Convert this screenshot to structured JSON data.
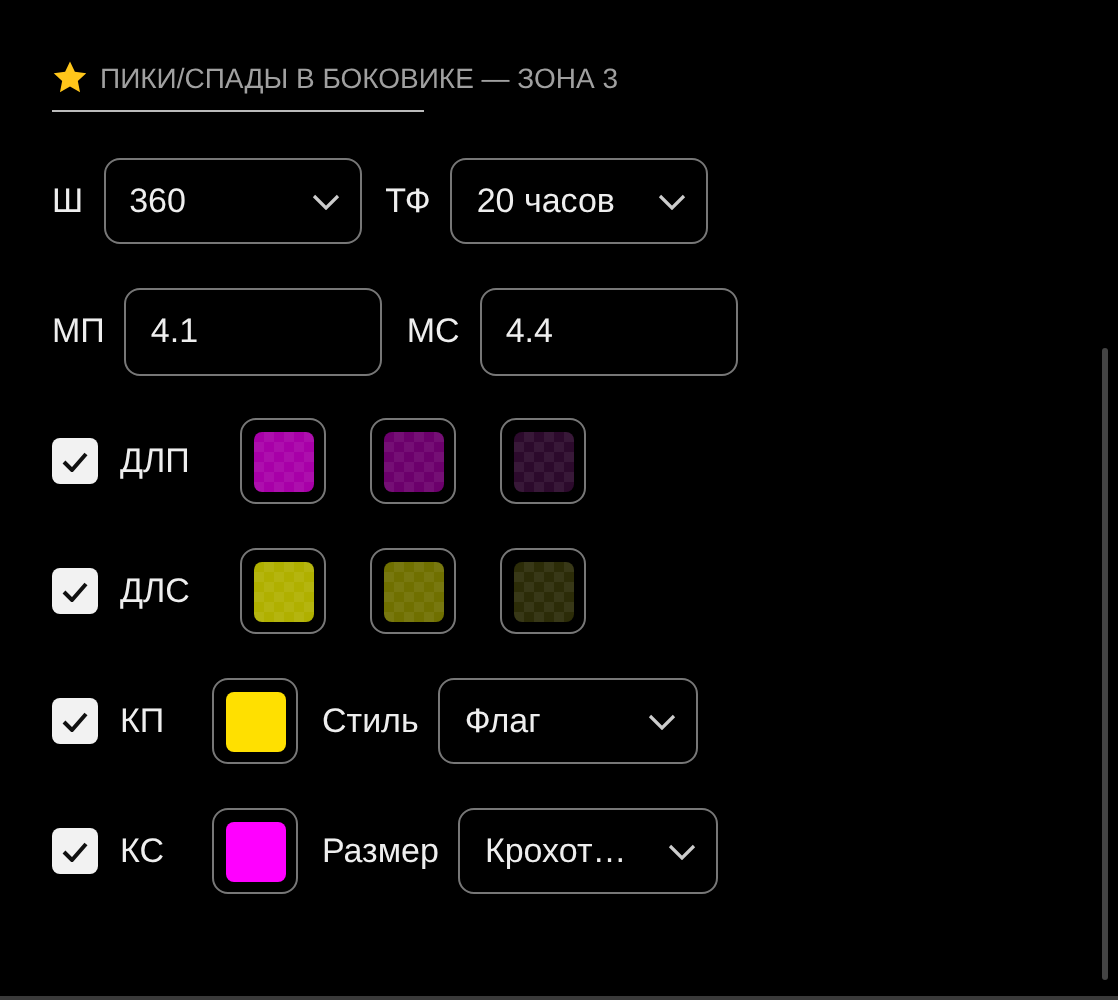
{
  "section": {
    "title": "ПИКИ/СПАДЫ В БОКОВИКЕ — ЗОНА 3"
  },
  "rows": [
    {
      "kind": "fields",
      "items": [
        {
          "kind": "select",
          "label": "Ш",
          "value": "360"
        },
        {
          "kind": "select",
          "label": "ТФ",
          "value": "20 часов"
        }
      ]
    },
    {
      "kind": "fields",
      "items": [
        {
          "kind": "input",
          "label": "МП",
          "value": "4.1"
        },
        {
          "kind": "input",
          "label": "МС",
          "value": "4.4"
        }
      ]
    },
    {
      "kind": "swatches",
      "label": "ДЛП",
      "checked": true,
      "swatches": [
        {
          "color": "#a800a8",
          "checker": true
        },
        {
          "color": "#6c006c",
          "checker": true
        },
        {
          "color": "#2c0a2c",
          "checker": true
        }
      ]
    },
    {
      "kind": "swatches",
      "label": "ДЛС",
      "checked": true,
      "swatches": [
        {
          "color": "#b0b000",
          "checker": true
        },
        {
          "color": "#707000",
          "checker": true
        },
        {
          "color": "#2c2c08",
          "checker": true
        }
      ]
    },
    {
      "kind": "option",
      "label": "КП",
      "checked": true,
      "color": "#ffe000",
      "option_label": "Стиль",
      "value": "Флаг"
    },
    {
      "kind": "option",
      "label": "КС",
      "checked": true,
      "color": "#ff00ff",
      "option_label": "Размер",
      "value": "Крохот…"
    }
  ]
}
